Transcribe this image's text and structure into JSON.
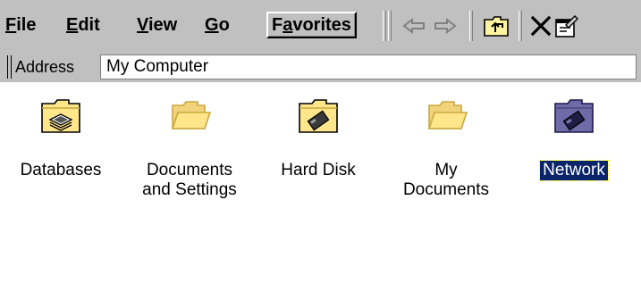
{
  "menu": {
    "file": {
      "mnemonic": "F",
      "rest": "ile"
    },
    "edit": {
      "mnemonic": "E",
      "rest": "dit"
    },
    "view": {
      "mnemonic": "V",
      "rest": "iew"
    },
    "go": {
      "mnemonic": "G",
      "rest": "o"
    },
    "favorites": {
      "pre": "F",
      "mnemonic": "a",
      "rest": "vorites"
    }
  },
  "toolbar": {
    "buttons": [
      {
        "icon": "back-arrow-icon",
        "enabled": false
      },
      {
        "icon": "forward-arrow-icon",
        "enabled": false
      },
      {
        "icon": "up-folder-icon",
        "enabled": true
      },
      {
        "icon": "close-icon",
        "enabled": true
      },
      {
        "icon": "properties-icon",
        "enabled": true
      }
    ]
  },
  "address": {
    "label": "Address",
    "value": "My Computer"
  },
  "items": [
    {
      "label_line1": "Databases",
      "label_line2": "",
      "icon": "database-icon",
      "selected": false
    },
    {
      "label_line1": "Documents",
      "label_line2": "and Settings",
      "icon": "folder-icon",
      "selected": false
    },
    {
      "label_line1": "Hard Disk",
      "label_line2": "",
      "icon": "hard-disk-icon",
      "selected": false
    },
    {
      "label_line1": "My",
      "label_line2": "Documents",
      "icon": "folder-icon",
      "selected": false
    },
    {
      "label_line1": "Network",
      "label_line2": "",
      "icon": "network-folder-icon",
      "selected": true
    }
  ],
  "colors": {
    "chrome": "#c0c0c0",
    "selection": "#0a246a",
    "folder": "#ffe68a"
  }
}
